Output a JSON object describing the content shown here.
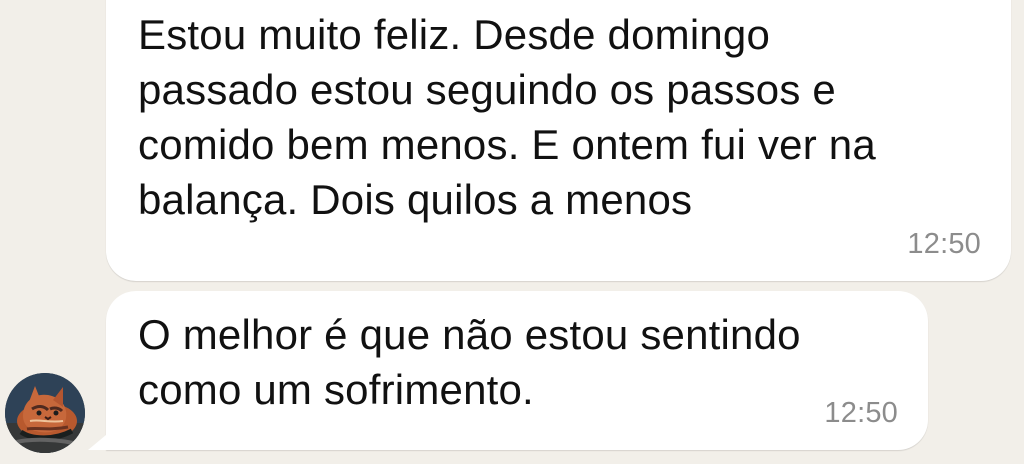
{
  "messages": [
    {
      "text": "Estou muito feliz. Desde domingo\npassado estou seguindo os passos e\ncomido bem menos. E ontem fui ver na\nbalança. Dois quilos a menos",
      "time": "12:50"
    },
    {
      "text": "O melhor é que não estou sentindo\ncomo um sofrimento.",
      "time": "12:50"
    }
  ],
  "contact": {
    "avatar_icon": "cat-avatar-icon"
  },
  "colors": {
    "chat_background": "#f2efe9",
    "bubble_background": "#ffffff",
    "timestamp": "#8c8c8c"
  }
}
